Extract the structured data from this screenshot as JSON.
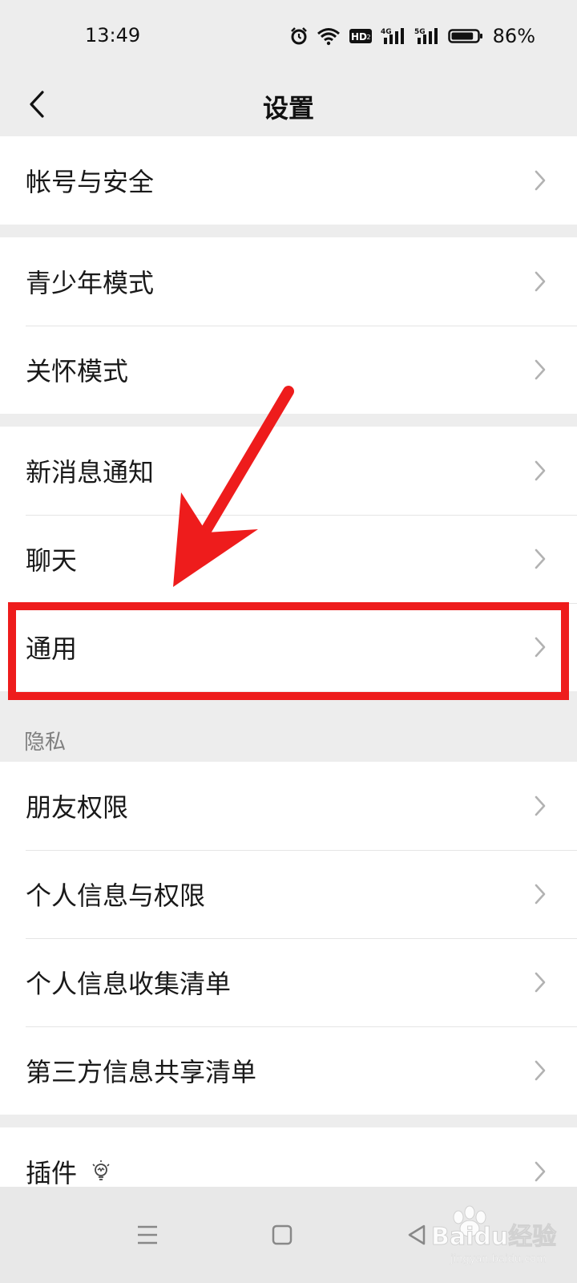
{
  "status_bar": {
    "time": "13:49",
    "battery_pct": "86%",
    "icons": [
      "alarm-icon",
      "wifi-icon",
      "hd-icon",
      "4g-signal-icon",
      "5g-signal-icon",
      "battery-icon"
    ],
    "hd_label": "HD",
    "net1": "4G",
    "net2": "5G",
    "battery_level": 0.86
  },
  "nav": {
    "back_icon": "chevron-left-icon",
    "title": "设置"
  },
  "groups": {
    "account": [
      "帐号与安全"
    ],
    "modes": [
      "青少年模式",
      "关怀模式"
    ],
    "general": [
      "新消息通知",
      "聊天",
      "通用"
    ],
    "privacy_label": "隐私",
    "privacy": [
      "朋友权限",
      "个人信息与权限",
      "个人信息收集清单",
      "第三方信息共享清单"
    ],
    "plugins": [
      "插件"
    ]
  },
  "annotation": {
    "color": "#ee1c1c",
    "highlighted_item": "通用"
  },
  "bottom_nav": {
    "icons": [
      "menu-icon",
      "home-square-icon",
      "back-triangle-icon"
    ]
  },
  "watermark": {
    "text": "Baidu经验",
    "sub": "jingyan.baidu.com"
  }
}
